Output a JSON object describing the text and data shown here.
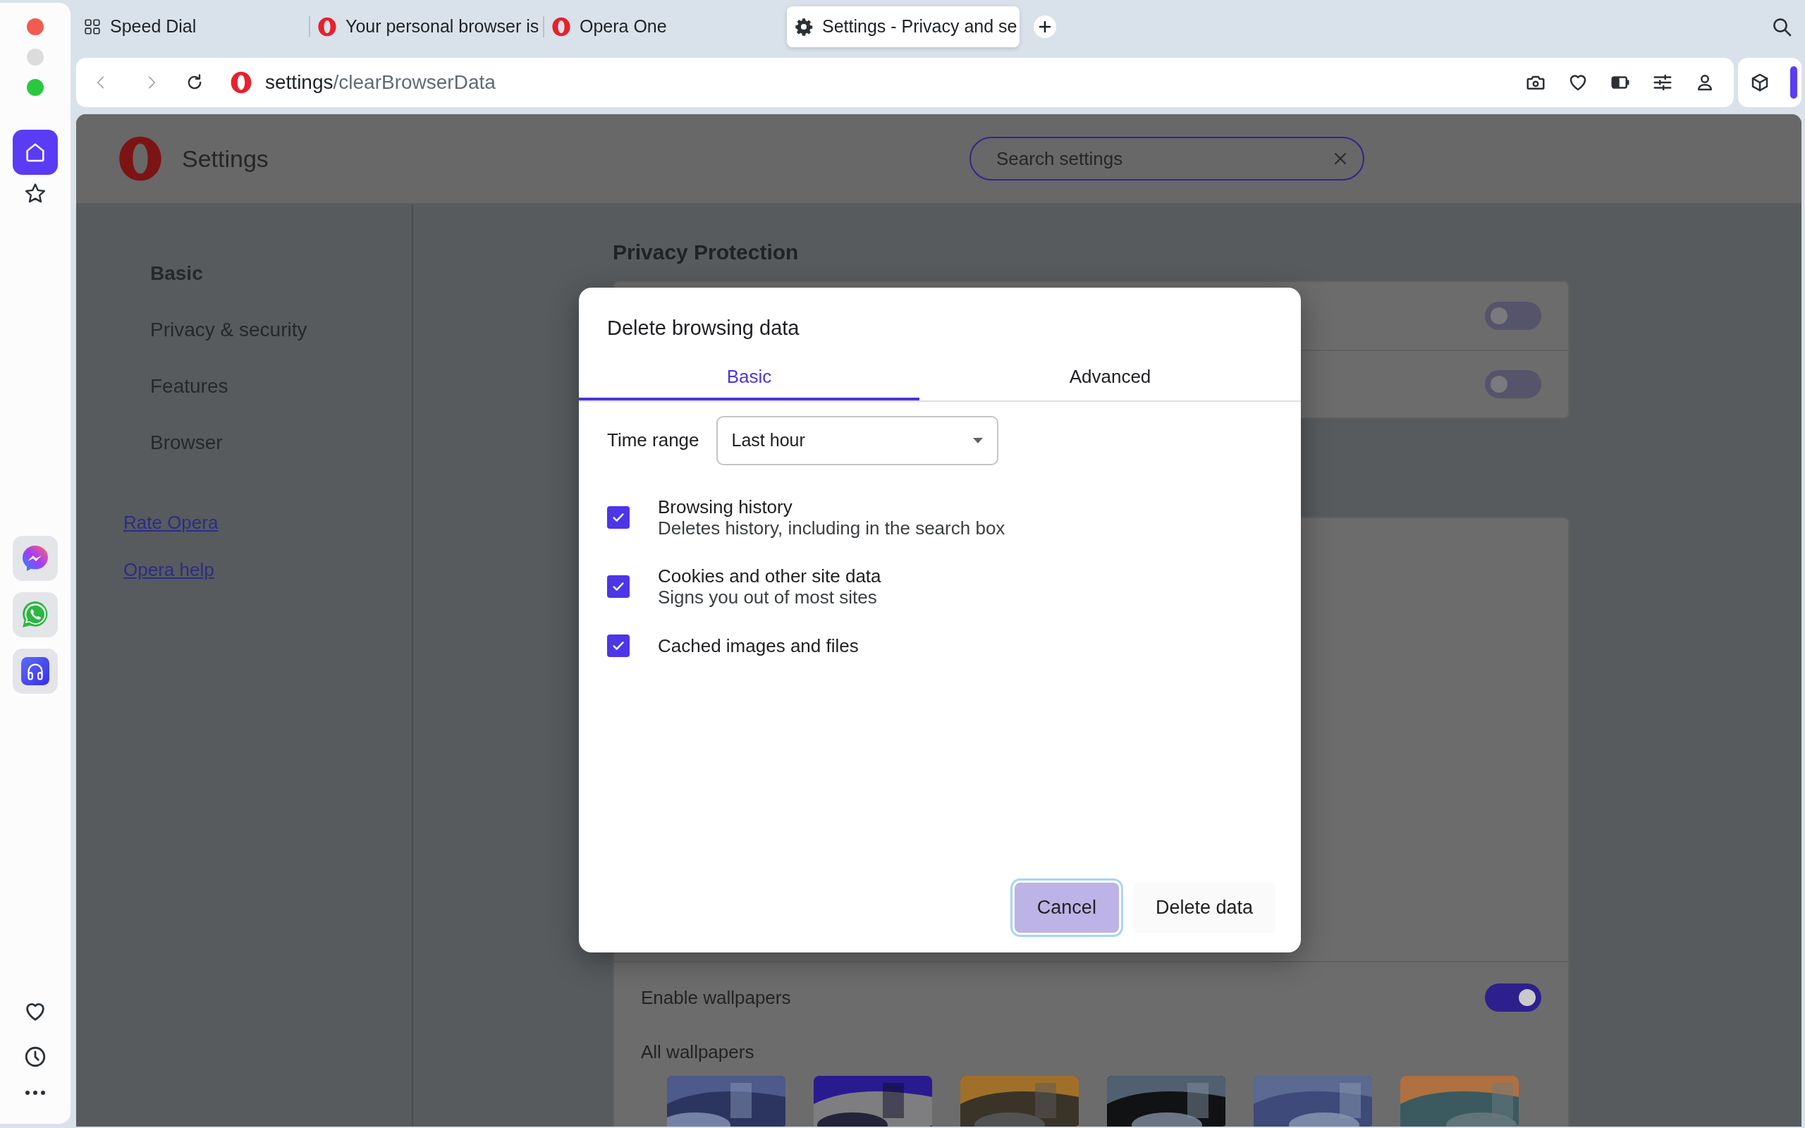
{
  "tabs": [
    {
      "kind": "speed-dial",
      "title": "Speed Dial",
      "selected": false
    },
    {
      "kind": "opera",
      "title": "Your personal browser is",
      "selected": false
    },
    {
      "kind": "opera",
      "title": "Opera One",
      "selected": false
    },
    {
      "kind": "settings",
      "title": "Settings - Privacy and se",
      "selected": true
    }
  ],
  "address_bar": {
    "host": "settings",
    "path": "/clearBrowserData"
  },
  "sidebar": {
    "items": [
      {
        "kind": "home",
        "selected": true
      },
      {
        "kind": "star",
        "selected": false
      }
    ]
  },
  "settings": {
    "title": "Settings",
    "search": {
      "placeholder": "Search settings"
    },
    "nav": [
      {
        "label": "Basic",
        "selected": true
      },
      {
        "label": "Privacy & security",
        "selected": false
      },
      {
        "label": "Features",
        "selected": false
      },
      {
        "label": "Browser",
        "selected": false
      }
    ],
    "links": [
      "Rate Opera",
      "Opera help"
    ],
    "section_title": "Privacy Protection",
    "toggles": [
      {
        "on": false
      },
      {
        "on": false
      }
    ],
    "wallpapers": {
      "label": "Enable wallpapers",
      "on": true,
      "heading": "All wallpapers"
    }
  },
  "dialog": {
    "title": "Delete browsing data",
    "tabs": [
      {
        "label": "Basic",
        "selected": true
      },
      {
        "label": "Advanced",
        "selected": false
      }
    ],
    "time_range": {
      "label": "Time range",
      "value": "Last hour"
    },
    "options": [
      {
        "title": "Browsing history",
        "description": "Deletes history, including in the search box",
        "checked": true
      },
      {
        "title": "Cookies and other site data",
        "description": "Signs you out of most sites",
        "checked": true
      },
      {
        "title": "Cached images and files",
        "checked": true
      }
    ],
    "buttons": [
      {
        "label": "Cancel",
        "kind": "tonal",
        "focused": true
      },
      {
        "label": "Delete data",
        "kind": "text",
        "focused": false
      }
    ]
  }
}
